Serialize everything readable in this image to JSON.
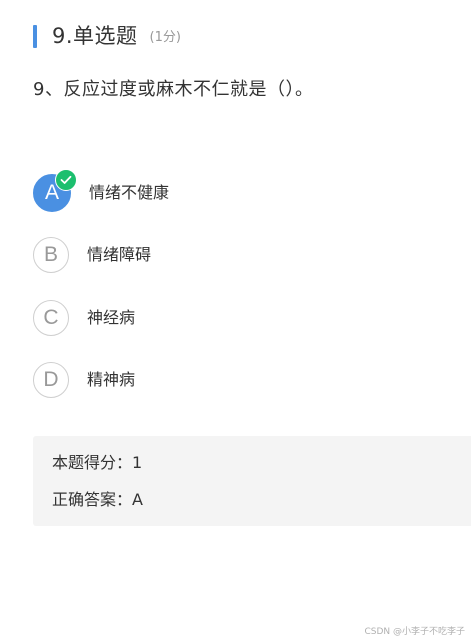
{
  "header": {
    "title": "9.单选题",
    "points": "(1分)"
  },
  "question": {
    "text": "9、反应过度或麻木不仁就是（）。"
  },
  "options": [
    {
      "letter": "A",
      "label": "情绪不健康",
      "selected": true
    },
    {
      "letter": "B",
      "label": "情绪障碍",
      "selected": false
    },
    {
      "letter": "C",
      "label": "神经病",
      "selected": false
    },
    {
      "letter": "D",
      "label": "精神病",
      "selected": false
    }
  ],
  "result": {
    "score_text": "本题得分：1",
    "answer_text": "正确答案：A"
  },
  "watermark": "CSDN @小李子不吃李子",
  "colors": {
    "accent": "#4a90e2",
    "check": "#1cbf6e",
    "result_bg": "#f4f4f4"
  },
  "icons": {
    "check_badge": "check-icon"
  }
}
